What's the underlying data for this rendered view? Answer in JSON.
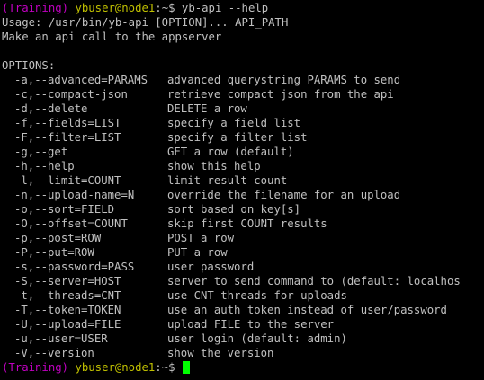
{
  "colors": {
    "background": "#000000",
    "text": "#c0c0c0",
    "env": "#c000c0",
    "user_host": "#c0c000",
    "cursor": "#00ff00"
  },
  "prompt": {
    "env": "(Training)",
    "user_host": "ybuser@node1",
    "suffix": ":~$"
  },
  "command": "yb-api --help",
  "usage": "Usage: /usr/bin/yb-api [OPTION]... API_PATH",
  "description": "Make an api call to the appserver",
  "options_header": "OPTIONS:",
  "options": [
    {
      "flag": "-a,--advanced=PARAMS",
      "desc": "advanced querystring PARAMS to send"
    },
    {
      "flag": "-c,--compact-json",
      "desc": "retrieve compact json from the api"
    },
    {
      "flag": "-d,--delete",
      "desc": "DELETE a row"
    },
    {
      "flag": "-f,--fields=LIST",
      "desc": "specify a field list"
    },
    {
      "flag": "-F,--filter=LIST",
      "desc": "specify a filter list"
    },
    {
      "flag": "-g,--get",
      "desc": "GET a row (default)"
    },
    {
      "flag": "-h,--help",
      "desc": "show this help"
    },
    {
      "flag": "-l,--limit=COUNT",
      "desc": "limit result count"
    },
    {
      "flag": "-n,--upload-name=N",
      "desc": "override the filename for an upload"
    },
    {
      "flag": "-o,--sort=FIELD",
      "desc": "sort based on key[s]"
    },
    {
      "flag": "-O,--offset=COUNT",
      "desc": "skip first COUNT results"
    },
    {
      "flag": "-p,--post=ROW",
      "desc": "POST a row"
    },
    {
      "flag": "-P,--put=ROW",
      "desc": "PUT a row"
    },
    {
      "flag": "-s,--password=PASS",
      "desc": "user password"
    },
    {
      "flag": "-S,--server=HOST",
      "desc": "server to send command to (default: localhos"
    },
    {
      "flag": "-t,--threads=CNT",
      "desc": "use CNT threads for uploads"
    },
    {
      "flag": "-T,--token=TOKEN",
      "desc": "use an auth token instead of user/password"
    },
    {
      "flag": "-U,--upload=FILE",
      "desc": "upload FILE to the server"
    },
    {
      "flag": "-u,--user=USER",
      "desc": "user login (default: admin)"
    },
    {
      "flag": "-V,--version",
      "desc": "show the version"
    }
  ]
}
